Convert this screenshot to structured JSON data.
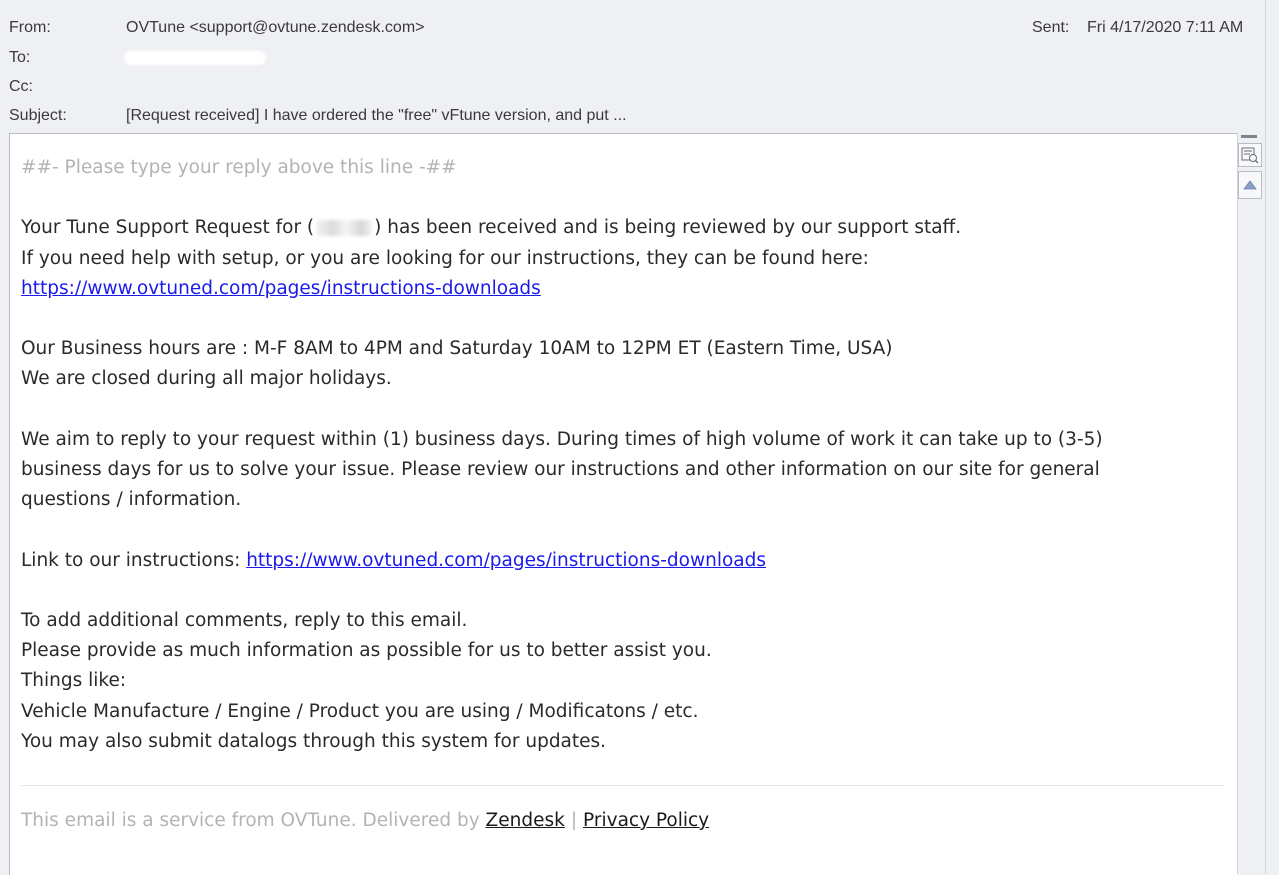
{
  "header": {
    "from_label": "From:",
    "from_value": "OVTune <support@ovtune.zendesk.com>",
    "to_label": "To:",
    "cc_label": "Cc:",
    "subject_label": "Subject:",
    "subject_value": "[Request received] I have ordered the \"free\" vFtune version, and put ...",
    "sent_label": "Sent:",
    "sent_value": "Fri 4/17/2020 7:11 AM"
  },
  "body": {
    "reply_marker": "##- Please type your reply above this line -##",
    "request_pre": "Your Tune Support Request for (",
    "request_post": ") has been received and is being reviewed by our support staff.",
    "setup_line": "If you need help with setup, or you are looking for our instructions, they can be found here:",
    "instructions_url": "https://www.ovtuned.com/pages/instructions-downloads",
    "hours_line": "Our Business hours are : M-F 8AM to 4PM and Saturday 10AM to 12PM ET (Eastern Time, USA)",
    "closed_line": "We are closed during all major holidays.",
    "aim_line_1": "We aim to reply to your request within (1) business days. During times of high volume of work it can take up to (3-5)",
    "aim_line_2": "business days for us to solve your issue. Please review our instructions and other information on our site for general",
    "aim_line_3": "questions / information.",
    "link_label": "Link to our instructions: ",
    "link_url": "https://www.ovtuned.com/pages/instructions-downloads",
    "comments_line": "To add additional comments, reply to this email.",
    "provide_line": "Please provide as much information as possible for us to better assist you.",
    "things_line": "Things like:",
    "vehicle_line": "Vehicle Manufacture / Engine / Product you are using / Modificatons / etc.",
    "datalogs_line": "You may also submit datalogs through this system for updates."
  },
  "footer": {
    "service_text": "This email is a service from OVTune. Delivered by ",
    "zendesk_link": "Zendesk",
    "separator": "|",
    "privacy_link": "Privacy Policy"
  },
  "colors": {
    "link": "#1a1aeb",
    "muted": "#b3b3b3",
    "header_bg": "#eef0f3"
  },
  "icons": {
    "zoom": "zoom-icon",
    "scroll_up": "scroll-up-arrow-icon"
  }
}
